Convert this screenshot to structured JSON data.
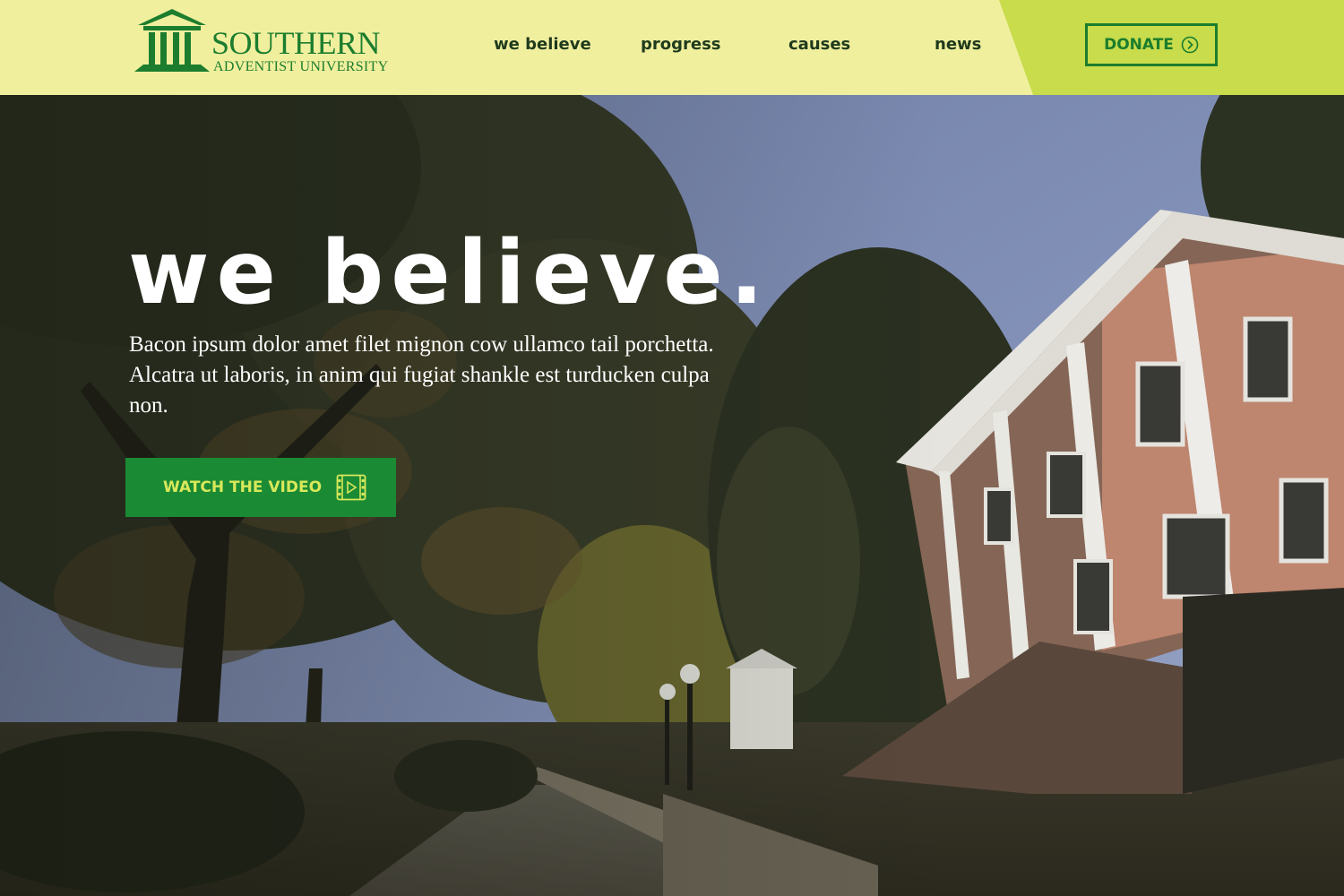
{
  "header": {
    "logo": {
      "name": "SOUTHERN",
      "subtitle": "ADVENTIST UNIVERSITY",
      "icon": "columns-building-icon"
    },
    "nav": [
      {
        "label": "we believe"
      },
      {
        "label": "progress"
      },
      {
        "label": "causes"
      },
      {
        "label": "news"
      }
    ],
    "donate": {
      "label": "DONATE",
      "icon": "chevron-circle-right-icon"
    }
  },
  "hero": {
    "title": "we believe.",
    "body": "Bacon ipsum dolor amet filet mignon cow ullamco tail porchetta. Alcatra ut laboris, in anim qui fugiat shankle est turducken culpa non.",
    "cta": {
      "label": "WATCH THE VIDEO",
      "icon": "film-play-icon"
    },
    "background": "campus-photo"
  },
  "colors": {
    "header_bg": "#f0ef9e",
    "header_accent": "#c8dc4c",
    "brand_green": "#1c7d2e",
    "cta_green": "#1b8a34",
    "cta_text": "#d8e85a"
  }
}
